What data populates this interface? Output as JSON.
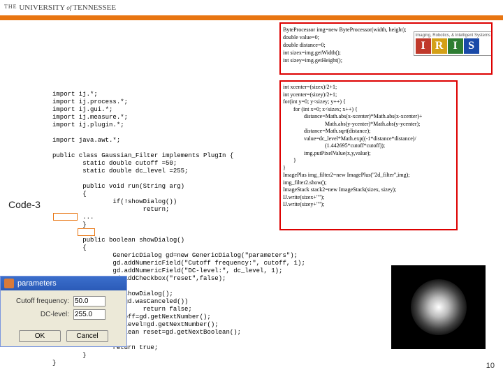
{
  "header": {
    "the": "THE",
    "u": "UNIVERSITY",
    "of": "of",
    "t": "TENNESSEE"
  },
  "iris": {
    "tag": "Imaging, Robotics, & Intelligent Systems",
    "l1": "I",
    "l2": "R",
    "l3": "I",
    "l4": "S"
  },
  "label": "Code-3",
  "code_main": "import ij.*;\nimport ij.process.*;\nimport ij.gui.*;\nimport ij.measure.*;\nimport ij.plugin.*;\n\nimport java.awt.*;\n\npublic class Gaussian_Filter implements PlugIn {\n        static double cutoff =50;\n        static double dc_level =255;\n\n        public void run(String arg)\n        {\n                if(!showDialog())\n                        return;\n        ...\n        }\n\n        public boolean showDialog()\n        {\n                GenericDialog gd=new GenericDialog(\"parameters\");\n                gd.addNumericField(\"Cutoff frequency:\", cutoff, 1);\n                gd.addNumericField(\"DC-level:\", dc_level, 1);\n                gd.addCheckbox(\"reset\",false);\n\n                gd.showDialog();\n                if(gd.wasCanceled())\n                        return false;\n                cutoff=gd.getNextNumber();\n                dc_level=gd.getNextNumber();\n                boolean reset=gd.getNextBoolean();\n\n                return true;\n        }\n}",
  "box1": {
    "l1": "ByteProcessor img=new ByteProcessor(width, height);",
    "l2": "double value=0;",
    "l3": "double distance=0;",
    "l4": "int sizex=img.getWidth();",
    "l5": "int sizey=img.getHeight();"
  },
  "box2": {
    "l1": "int xcenter=(sizex)/2+1;",
    "l2": "int ycenter=(sizey)/2+1;",
    "l3": "",
    "l4": "for(int y=0; y<sizey; y++) {",
    "l5": "for (int x=0; x<sizex; x++) {",
    "l6": "distance=Math.abs(x-xcenter)*Math.abs(x-xcenter)+",
    "l7": "Math.abs(y-ycenter)*Math.abs(y-ycenter);",
    "l8": "distance=Math.sqrt(distance);",
    "l9": "value=dc_level*Math.exp((-1*distance*distance)/",
    "l10": "(1.442695*cutoff*cutoff));",
    "l11": "img.putPixelValue(x,y,value);",
    "l12": "}",
    "l13": "}",
    "l14": "",
    "l15": "ImagePlus img_filter2=new ImagePlus(\"2d_filter\",img);",
    "l16": "img_filter2.show();",
    "l17": "",
    "l18": "ImageStack stack2=new ImageStack(sizex, sizey);",
    "l19": "IJ.write(sizex+\"\");",
    "l20": "IJ.write(sizey+\"\");"
  },
  "dialog": {
    "title": "parameters",
    "f1_label": "Cutoff frequency:",
    "f1_val": "50.0",
    "f2_label": "DC-level:",
    "f2_val": "255.0",
    "ok": "OK",
    "cancel": "Cancel"
  },
  "page": "10"
}
